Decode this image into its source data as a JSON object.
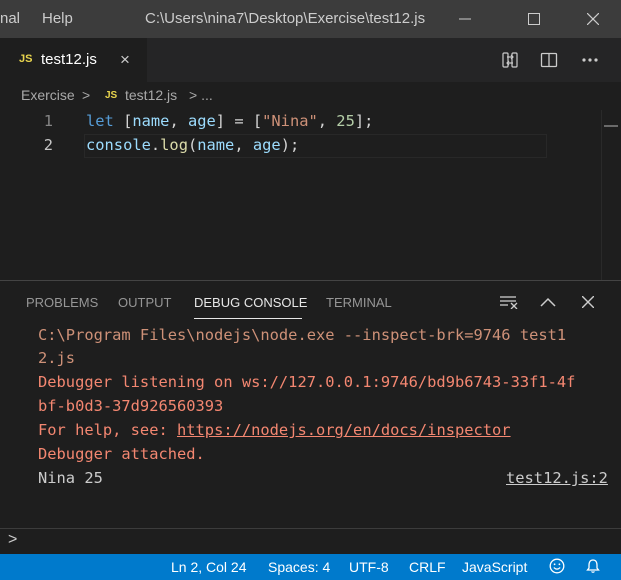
{
  "titlebar": {
    "menu": [
      "nal",
      "Help"
    ],
    "title": "C:\\Users\\nina7\\Desktop\\Exercise\\test12.js"
  },
  "tab": {
    "js_badge": "JS",
    "label": "test12.js",
    "close": "×"
  },
  "breadcrumb": {
    "folder": "Exercise",
    "sep": ">",
    "js_badge": "JS",
    "file": "test12.js",
    "ellipsis": "> ..."
  },
  "editor": {
    "lines": [
      {
        "num": "1",
        "tokens": {
          "let": "let",
          "lb": " [",
          "a": "name",
          "comma": ", ",
          "b": "age",
          "rb": "] = [",
          "s": "\"Nina\"",
          "c2": ", ",
          "n": "25",
          "end": "];"
        }
      },
      {
        "num": "2",
        "tokens": {
          "obj": "console",
          "dot": ".",
          "fn": "log",
          "op": "(",
          "a": "name",
          "comma": ", ",
          "b": "age",
          "end": ");"
        }
      }
    ]
  },
  "panel": {
    "tabs": [
      "PROBLEMS",
      "OUTPUT",
      "DEBUG CONSOLE",
      "TERMINAL"
    ],
    "active_tab": "DEBUG CONSOLE",
    "console": {
      "line1": "C:\\Program Files\\nodejs\\node.exe --inspect-brk=9746 test1",
      "line2": "2.js",
      "line3": "Debugger listening on ws://127.0.0.1:9746/bd9b6743-33f1-4f",
      "line4": "bf-b0d3-37d926560393",
      "line5_prefix": "For help, see: ",
      "line5_link": "https://nodejs.org/en/docs/inspector",
      "line6": "Debugger attached.",
      "line7": "Nina 25",
      "source_link": "test12.js:2"
    },
    "repl_prompt": ">"
  },
  "statusbar": {
    "position": "Ln 2, Col 24",
    "spaces": "Spaces: 4",
    "encoding": "UTF-8",
    "eol": "CRLF",
    "language": "JavaScript"
  },
  "colors": {
    "statusbar": "#007acc",
    "titlebar": "#3c3c3c",
    "editor": "#1e1e1e"
  }
}
